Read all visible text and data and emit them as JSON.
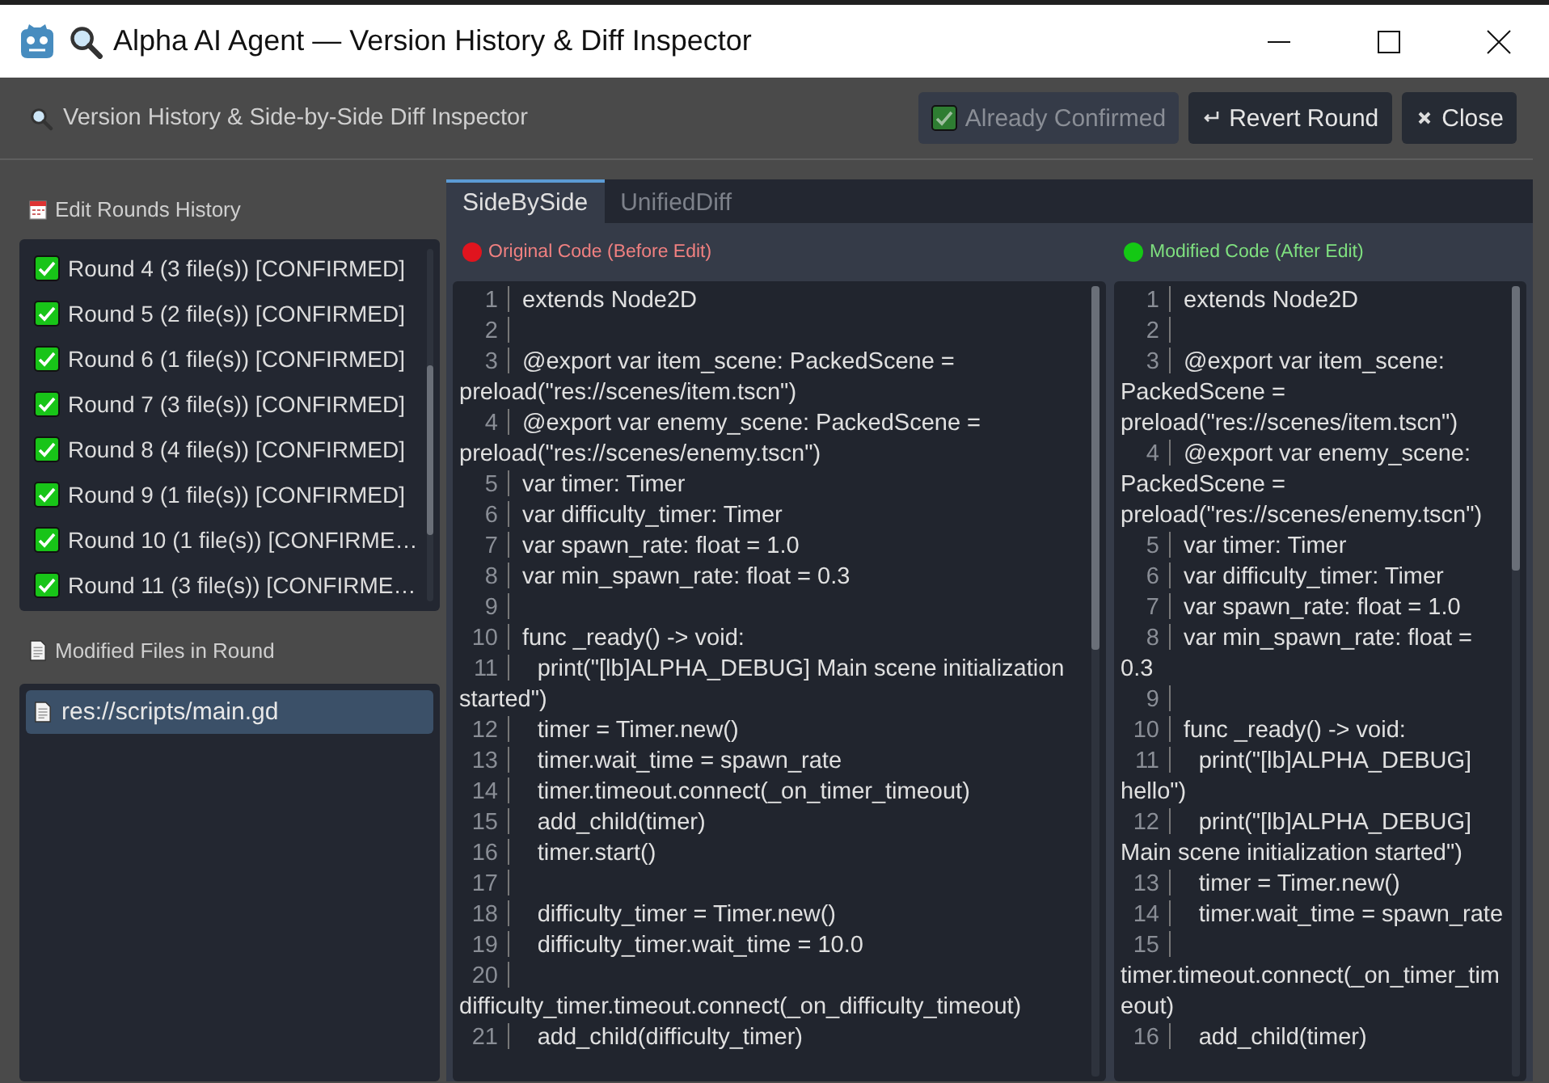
{
  "window": {
    "title": "Alpha AI Agent — Version History & Diff Inspector"
  },
  "header": {
    "title": "Version History & Side-by-Side Diff Inspector",
    "confirmed": {
      "label": "Already Confirmed",
      "checked": true,
      "disabled": true
    },
    "buttons": [
      {
        "label": "Revert Round"
      },
      {
        "label": "Close"
      }
    ]
  },
  "rounds": {
    "title": "Edit Rounds History",
    "items": [
      {
        "label": "Round 4 (3 file(s)) [CONFIRMED]",
        "checked": true
      },
      {
        "label": "Round 5 (2 file(s)) [CONFIRMED]",
        "checked": true
      },
      {
        "label": "Round 6 (1 file(s)) [CONFIRMED]",
        "checked": true
      },
      {
        "label": "Round 7 (3 file(s)) [CONFIRMED]",
        "checked": true
      },
      {
        "label": "Round 8 (4 file(s)) [CONFIRMED]",
        "checked": true
      },
      {
        "label": "Round 9 (1 file(s)) [CONFIRMED]",
        "checked": true
      },
      {
        "label": "Round 10 (1 file(s)) [CONFIRME…",
        "checked": true
      },
      {
        "label": "Round 11 (3 file(s)) [CONFIRME…",
        "checked": true
      }
    ]
  },
  "files": {
    "title": "Modified Files in Round",
    "items": [
      {
        "label": "res://scripts/main.gd",
        "selected": true
      }
    ]
  },
  "tabs": [
    {
      "label": "SideBySide",
      "selected": true
    },
    {
      "label": "UnifiedDiff",
      "selected": false
    }
  ],
  "panes": [
    {
      "title": "Original Code (Before Edit)",
      "color": "#e0141e",
      "lines": [
        {
          "n": "1",
          "text": "extends Node2D"
        },
        {
          "n": "2"
        },
        {
          "n": "3",
          "text": "@export var item_scene: PackedScene = preload(\"res://scenes/item.tscn\")"
        },
        {
          "n": "4",
          "text": "@export var enemy_scene: PackedScene = preload(\"res://scenes/enemy.tscn\")"
        },
        {
          "n": "5",
          "text": "var timer: Timer"
        },
        {
          "n": "6",
          "text": "var difficulty_timer: Timer"
        },
        {
          "n": "7",
          "text": "var spawn_rate: float = 1.0"
        },
        {
          "n": "8",
          "text": "var min_spawn_rate: float = 0.3"
        },
        {
          "n": "9"
        },
        {
          "n": "10",
          "text": "func _ready() -> void:"
        },
        {
          "n": "11",
          "text": "\tprint(\"[lb]ALPHA_DEBUG] Main scene initialization started\")"
        },
        {
          "n": "12",
          "text": "\ttimer = Timer.new()"
        },
        {
          "n": "13",
          "text": "\ttimer.wait_time = spawn_rate"
        },
        {
          "n": "14",
          "text": "\ttimer.timeout.connect(_on_timer_timeout)"
        },
        {
          "n": "15",
          "text": "\tadd_child(timer)"
        },
        {
          "n": "16",
          "text": "\ttimer.start()"
        },
        {
          "n": "17"
        },
        {
          "n": "18",
          "text": "\tdifficulty_timer = Timer.new()"
        },
        {
          "n": "19",
          "text": "\tdifficulty_timer.wait_time = 10.0"
        },
        {
          "n": "20",
          "text": "\tdifficulty_timer.timeout.connect(_on_difficulty_timeout)"
        },
        {
          "n": "21",
          "text": "\tadd_child(difficulty_timer)"
        }
      ]
    },
    {
      "title": "Modified Code (After Edit)",
      "color": "#14c814",
      "lines": [
        {
          "n": "1",
          "text": "extends Node2D"
        },
        {
          "n": "2"
        },
        {
          "n": "3",
          "text": "@export var item_scene: PackedScene = preload(\"res://scenes/item.tscn\")"
        },
        {
          "n": "4",
          "text": "@export var enemy_scene: PackedScene = preload(\"res://scenes/enemy.tscn\")"
        },
        {
          "n": "5",
          "text": "var timer: Timer"
        },
        {
          "n": "6",
          "text": "var difficulty_timer: Timer"
        },
        {
          "n": "7",
          "text": "var spawn_rate: float = 1.0"
        },
        {
          "n": "8",
          "text": "var min_spawn_rate: float = 0.3"
        },
        {
          "n": "9"
        },
        {
          "n": "10",
          "text": "func _ready() -> void:"
        },
        {
          "n": "11",
          "text": "\tprint(\"[lb]ALPHA_DEBUG] hello\")"
        },
        {
          "n": "12",
          "text": "\tprint(\"[lb]ALPHA_DEBUG] Main scene initialization started\")"
        },
        {
          "n": "13",
          "text": "\ttimer = Timer.new()"
        },
        {
          "n": "14",
          "text": "\ttimer.wait_time = spawn_rate"
        },
        {
          "n": "15",
          "text": "\ttimer.timeout.connect(_on_timer_timeout)"
        },
        {
          "n": "16",
          "text": "\tadd_child(timer)"
        }
      ]
    }
  ]
}
